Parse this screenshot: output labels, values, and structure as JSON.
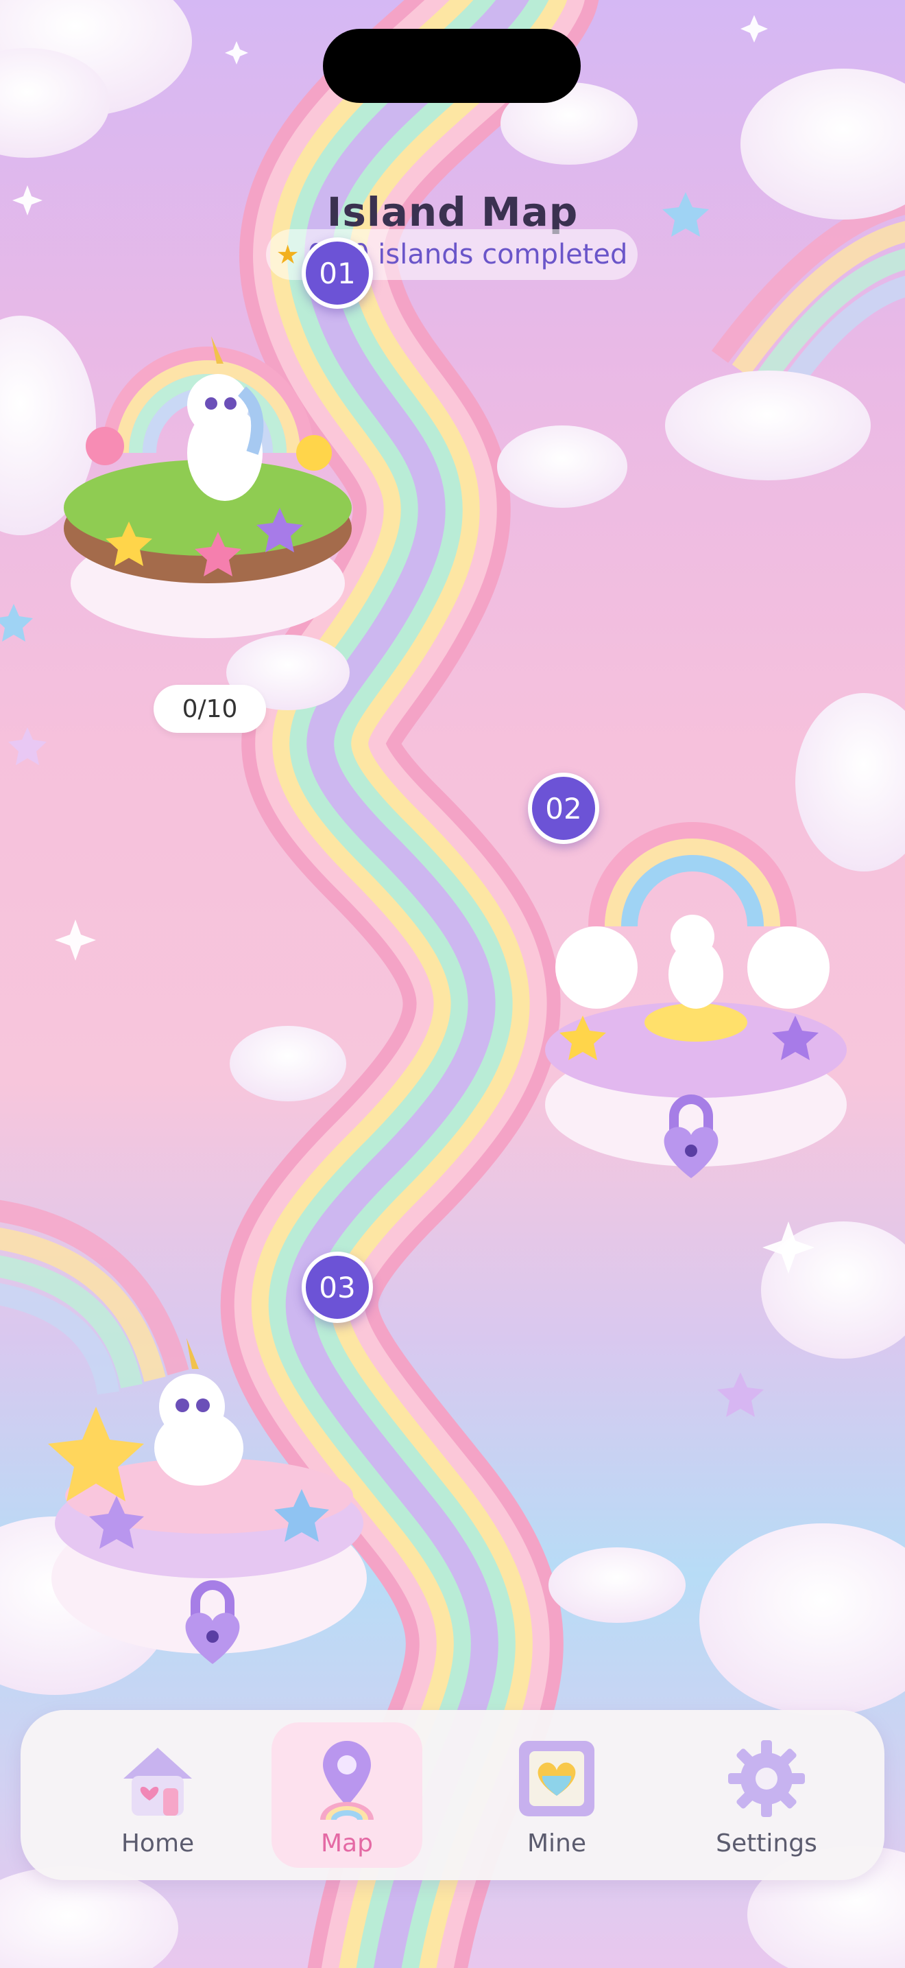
{
  "header": {
    "title": "Island Map",
    "progress_text": "0/10 islands completed",
    "progress_icon": "star-icon"
  },
  "islands": [
    {
      "number": "01",
      "progress": "0/10",
      "status": "unlocked"
    },
    {
      "number": "02",
      "status": "locked"
    },
    {
      "number": "03",
      "status": "locked"
    }
  ],
  "tabbar": {
    "active": "Map",
    "tabs": [
      {
        "label": "Home",
        "icon": "house-icon"
      },
      {
        "label": "Map",
        "icon": "map-pin-icon"
      },
      {
        "label": "Mine",
        "icon": "heart-frame-icon"
      },
      {
        "label": "Settings",
        "icon": "gear-icon"
      }
    ]
  },
  "colors": {
    "accent": "#6c53d6",
    "active_tab": "#e469a4",
    "title": "#3a3150"
  }
}
